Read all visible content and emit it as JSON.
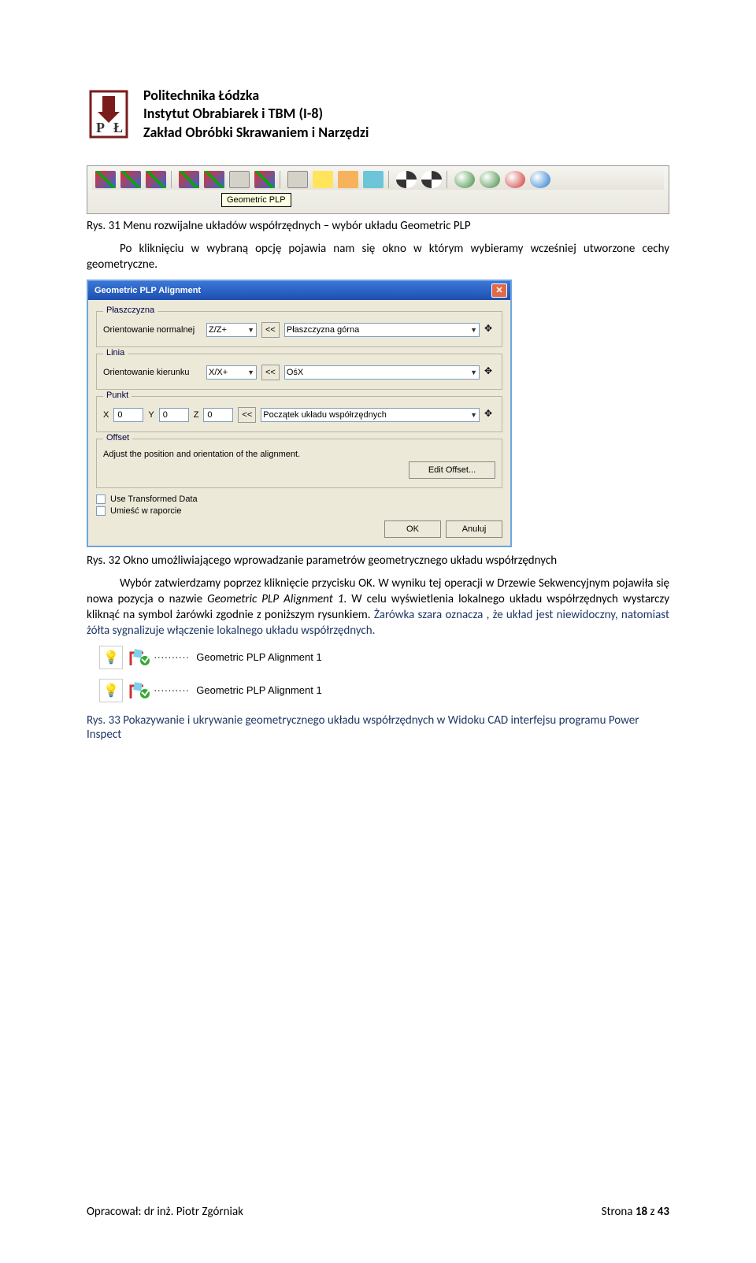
{
  "header": {
    "line1": "Politechnika Łódzka",
    "line2": "Instytut Obrabiarek i TBM (I-8)",
    "line3": "Zakład Obróbki Skrawaniem i Narzędzi"
  },
  "toolbar": {
    "tooltip": "Geometric PLP"
  },
  "captions": {
    "fig31": "Rys. 31 Menu rozwijalne układów współrzędnych – wybór układu Geometric PLP",
    "fig32": "Rys. 32 Okno umożliwiającego wprowadzanie parametrów geometrycznego układu współrzędnych",
    "fig33": "Rys. 33 Pokazywanie i ukrywanie geometrycznego układu współrzędnych w Widoku CAD interfejsu programu Power Inspect"
  },
  "paras": {
    "p1": "Po kliknięciu w wybraną opcję pojawia nam się okno w którym wybieramy wcześniej utworzone cechy geometryczne.",
    "p2a": "Wybór zatwierdzamy poprzez kliknięcie przycisku OK. W wyniku tej operacji w Drzewie Sekwencyjnym pojawiła się nowa pozycja o nazwie ",
    "p2b": ". W celu wyświetlenia lokalnego układu współrzędnych wystarczy kliknąć na symbol żarówki zgodnie z poniższym rysunkiem. ",
    "p2c": "Żarówka szara oznacza , że układ jest niewidoczny, natomiast żółta sygnalizuje włączenie lokalnego układu współrzędnych.",
    "em": "Geometric PLP Alignment 1"
  },
  "dialog": {
    "title": "Geometric PLP Alignment",
    "grp_plane": "Płaszczyzna",
    "grp_line": "Linia",
    "grp_point": "Punkt",
    "grp_offset": "Offset",
    "lbl_orient_normal": "Orientowanie normalnej",
    "lbl_orient_dir": "Orientowanie kierunku",
    "sel_zz": "Z/Z+",
    "sel_xx": "X/X+",
    "sel_plane_top": "Płaszczyzna górna",
    "sel_axis_x": "OśX",
    "sel_origin": "Początek układu współrzędnych",
    "lbl_x": "X",
    "lbl_y": "Y",
    "lbl_z": "Z",
    "val_x": "0",
    "val_y": "0",
    "val_z": "0",
    "offset_text": "Adjust the position and orientation of the alignment.",
    "btn_edit_offset": "Edit Offset...",
    "chk_transformed": "Use Transformed Data",
    "chk_report": "Umieść w raporcie",
    "btn_ok": "OK",
    "btn_cancel": "Anuluj",
    "ll": "<<"
  },
  "plp_items": {
    "label": "Geometric PLP Alignment 1"
  },
  "footer": {
    "left": "Opracował: dr inż. Piotr Zgórniak",
    "right_a": "Strona ",
    "right_b": "18",
    "right_c": " z ",
    "right_d": "43"
  }
}
